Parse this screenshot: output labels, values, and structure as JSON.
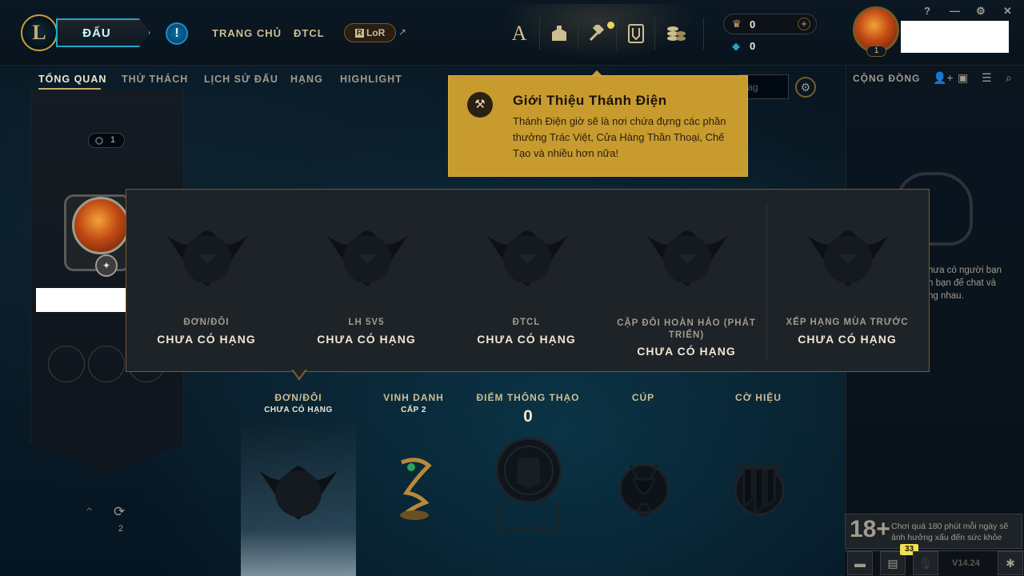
{
  "colors": {
    "gold": "#c8aa6e",
    "blue_accent": "#1fa5c8",
    "tooltip_bg": "#c89b2e",
    "dark_panel": "#1e2328"
  },
  "topbar": {
    "play_label": "ĐẤU",
    "alert_icon": "!",
    "nav": {
      "home": "TRANG CHỦ",
      "tft": "ĐTCL",
      "lor": "LoR",
      "lor_mark": "R"
    },
    "hub_icons": [
      "profile-hub-icon",
      "collection-icon",
      "crafting-icon",
      "loot-icon",
      "store-icon"
    ],
    "currency": {
      "rp": "0",
      "blue_essence": "0"
    },
    "avatar_level": "1",
    "window_controls": {
      "help": "?",
      "minimize": "—",
      "settings": "⚙",
      "close": "✕"
    }
  },
  "subnav": {
    "tabs": [
      "TỔNG QUAN",
      "THỬ THÁCH",
      "LỊCH SỬ ĐẤU",
      "HẠNG",
      "HIGHLIGHT"
    ],
    "search_placeholder": "tag"
  },
  "tooltip": {
    "title": "Giới Thiệu Thánh Điện",
    "body": "Thánh Điện giờ sẽ là nơi chứa đựng các phần thưởng Trác Việt, Cửa Hàng Thần Thoại, Chế Tạo và nhiều hơn nữa!"
  },
  "left": {
    "mastery_chip": "1",
    "reroll_count": "2"
  },
  "ranks": [
    {
      "queue": "ĐƠN/ĐÔI",
      "status": "CHƯA CÓ HẠNG"
    },
    {
      "queue": "LH 5V5",
      "status": "CHƯA CÓ HẠNG"
    },
    {
      "queue": "ĐTCL",
      "status": "CHƯA CÓ HẠNG"
    },
    {
      "queue": "CẶP ĐÔI HOÀN HẢO (PHÁT TRIỂN)",
      "status": "CHƯA CÓ HẠNG"
    },
    {
      "queue": "XẾP HẠNG MÙA TRƯỚC",
      "status": "CHƯA CÓ HẠNG"
    }
  ],
  "stats": {
    "rank": {
      "head": "ĐƠN/ĐÔI",
      "sub": "CHƯA CÓ HẠNG"
    },
    "honor": {
      "head": "VINH DANH",
      "sub": "CẤP 2"
    },
    "mastery": {
      "head": "ĐIỂM THÔNG THẠO",
      "value": "0"
    },
    "trophy": {
      "head": "CÚP"
    },
    "banner": {
      "head": "CỜ HIỆU"
    }
  },
  "social": {
    "title": "CỘNG ĐỒNG",
    "empty_text": "hưa có người bạn\nn bạn để chat và\nng nhau."
  },
  "footer": {
    "age_badge": "18+",
    "age_text": "Chơi quá 180 phút mỗi ngày sẽ ảnh hưởng xấu đến sức khỏe",
    "missions_count": "33",
    "version": "V14.24"
  }
}
